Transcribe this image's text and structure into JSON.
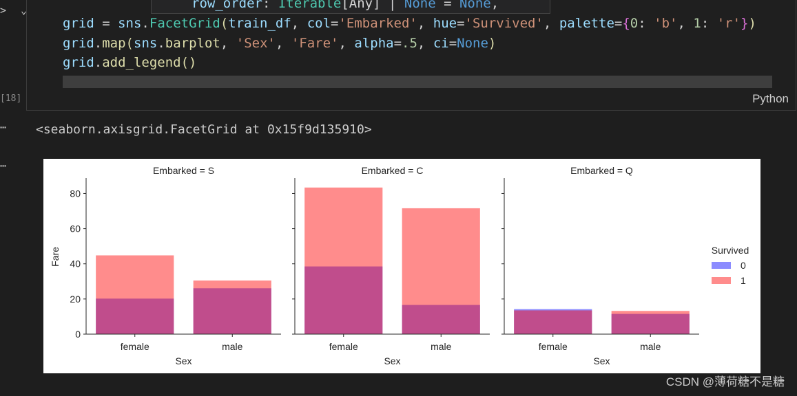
{
  "gutter": {
    "chevrons": "> ⌄",
    "execution_count": "[18]",
    "output_dots_1": "⋯",
    "output_dots_2": "⋯"
  },
  "tooltip": {
    "param": "row_order",
    "colon": ": ",
    "type1": "Iterable",
    "type2": "[Any] | ",
    "none1": "None",
    "eq": " = ",
    "none2": "None",
    "comma": ","
  },
  "code": {
    "line1": [
      {
        "t": "grid",
        "c": "kw"
      },
      {
        "t": " = ",
        "c": "plain"
      },
      {
        "t": "sns",
        "c": "kw"
      },
      {
        "t": ".",
        "c": "plain"
      },
      {
        "t": "FacetGrid",
        "c": "cls"
      },
      {
        "t": "(",
        "c": "fn"
      },
      {
        "t": "train_df",
        "c": "kw"
      },
      {
        "t": ", ",
        "c": "plain"
      },
      {
        "t": "col",
        "c": "kw"
      },
      {
        "t": "=",
        "c": "plain"
      },
      {
        "t": "'Embarked'",
        "c": "str"
      },
      {
        "t": ", ",
        "c": "plain"
      },
      {
        "t": "hue",
        "c": "kw"
      },
      {
        "t": "=",
        "c": "plain"
      },
      {
        "t": "'Survived'",
        "c": "str"
      },
      {
        "t": ", ",
        "c": "plain"
      },
      {
        "t": "palette",
        "c": "kw"
      },
      {
        "t": "=",
        "c": "plain"
      },
      {
        "t": "{",
        "c": "brk"
      },
      {
        "t": "0",
        "c": "num"
      },
      {
        "t": ": ",
        "c": "plain"
      },
      {
        "t": "'b'",
        "c": "str"
      },
      {
        "t": ", ",
        "c": "plain"
      },
      {
        "t": "1",
        "c": "num"
      },
      {
        "t": ": ",
        "c": "plain"
      },
      {
        "t": "'r'",
        "c": "str"
      },
      {
        "t": "}",
        "c": "brk"
      },
      {
        "t": ")",
        "c": "fn"
      }
    ],
    "line2": [
      {
        "t": "grid",
        "c": "kw"
      },
      {
        "t": ".",
        "c": "plain"
      },
      {
        "t": "map",
        "c": "fn"
      },
      {
        "t": "(",
        "c": "fn"
      },
      {
        "t": "sns",
        "c": "kw"
      },
      {
        "t": ".",
        "c": "plain"
      },
      {
        "t": "barplot",
        "c": "fn"
      },
      {
        "t": ", ",
        "c": "plain"
      },
      {
        "t": "'Sex'",
        "c": "str"
      },
      {
        "t": ", ",
        "c": "plain"
      },
      {
        "t": "'Fare'",
        "c": "str"
      },
      {
        "t": ", ",
        "c": "plain"
      },
      {
        "t": "alpha",
        "c": "kw"
      },
      {
        "t": "=",
        "c": "plain"
      },
      {
        "t": ".5",
        "c": "num"
      },
      {
        "t": ", ",
        "c": "plain"
      },
      {
        "t": "ci",
        "c": "kw"
      },
      {
        "t": "=",
        "c": "plain"
      },
      {
        "t": "None",
        "c": "const"
      },
      {
        "t": ")",
        "c": "fn"
      }
    ],
    "line3": [
      {
        "t": "grid",
        "c": "kw"
      },
      {
        "t": ".",
        "c": "plain"
      },
      {
        "t": "add_legend",
        "c": "fn"
      },
      {
        "t": "()",
        "c": "fn"
      }
    ],
    "language": "Python"
  },
  "output": {
    "repr": "<seaborn.axisgrid.FacetGrid at 0x15f9d135910>"
  },
  "chart_data": {
    "type": "bar",
    "panels": [
      {
        "title": "Embarked = S",
        "categories": [
          "female",
          "male"
        ],
        "series": [
          {
            "name": "0",
            "values": [
              20.2,
              26.1
            ]
          },
          {
            "name": "1",
            "values": [
              44.8,
              30.5
            ]
          }
        ]
      },
      {
        "title": "Embarked = C",
        "categories": [
          "female",
          "male"
        ],
        "series": [
          {
            "name": "0",
            "values": [
              38.5,
              16.6
            ]
          },
          {
            "name": "1",
            "values": [
              83.4,
              71.6
            ]
          }
        ]
      },
      {
        "title": "Embarked = Q",
        "categories": [
          "female",
          "male"
        ],
        "series": [
          {
            "name": "0",
            "values": [
              14.2,
              11.5
            ]
          },
          {
            "name": "1",
            "values": [
              13.5,
              13.2
            ]
          }
        ]
      }
    ],
    "xlabel": "Sex",
    "ylabel": "Fare",
    "ylim": [
      0,
      88
    ],
    "yticks": [
      "0",
      "20",
      "40",
      "60",
      "80"
    ],
    "legend": {
      "title": "Survived",
      "entries": [
        "0",
        "1"
      ],
      "placement": "right"
    },
    "colors": {
      "0": "#0000ff",
      "1": "#ff0000"
    },
    "alpha": 0.45
  },
  "watermark": "CSDN @薄荷糖不是糖"
}
